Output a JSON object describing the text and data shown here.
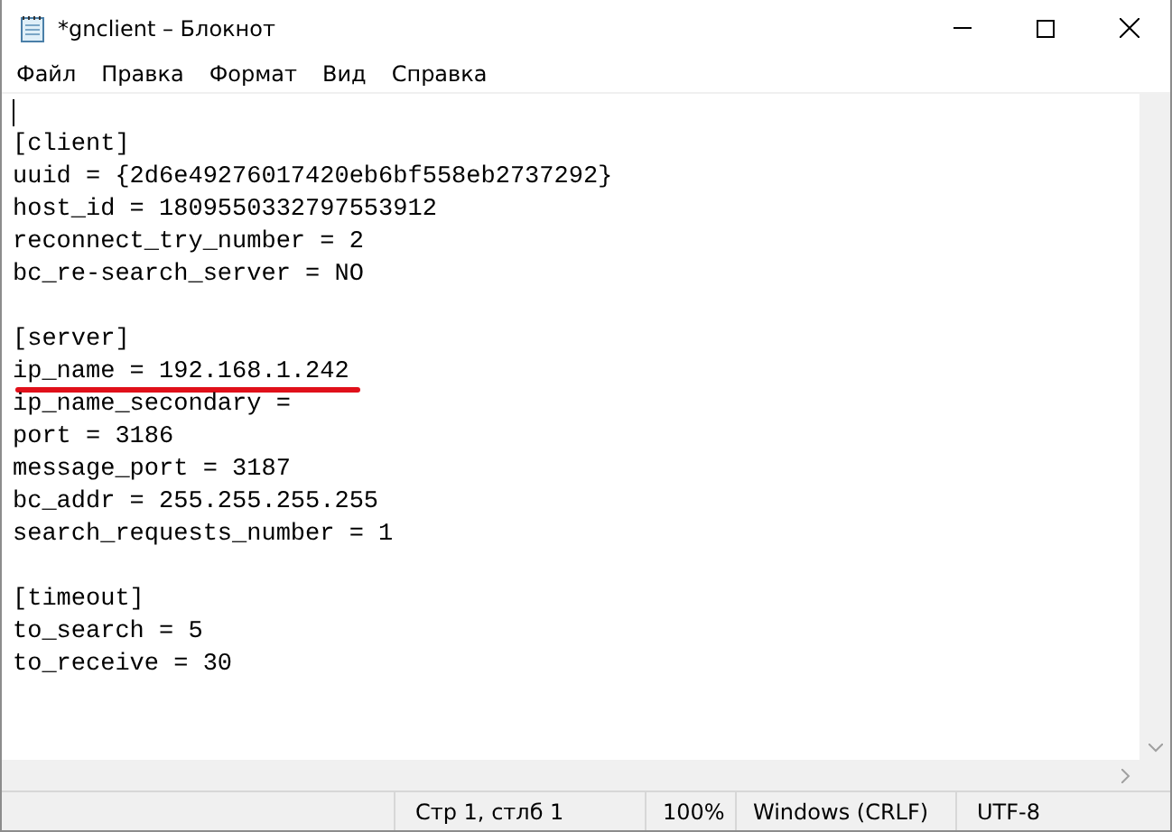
{
  "window": {
    "title": "*gnclient – Блокнот"
  },
  "menu": [
    "Файл",
    "Правка",
    "Формат",
    "Вид",
    "Справка"
  ],
  "editor": {
    "lines": [
      {
        "kind": "caret"
      },
      {
        "kind": "text",
        "text": "[client]"
      },
      {
        "kind": "text",
        "text": "uuid = {2d6e49276017420eb6bf558eb2737292}"
      },
      {
        "kind": "text",
        "text": "host_id = 1809550332797553912"
      },
      {
        "kind": "text",
        "text": "reconnect_try_number = 2"
      },
      {
        "kind": "text",
        "text": "bc_re-search_server = NO"
      },
      {
        "kind": "blank"
      },
      {
        "kind": "text",
        "text": "[server]"
      },
      {
        "kind": "text",
        "text": "ip_name = 192.168.1.242",
        "underlined": true
      },
      {
        "kind": "text",
        "text": "ip_name_secondary ="
      },
      {
        "kind": "text",
        "text": "port = 3186"
      },
      {
        "kind": "text",
        "text": "message_port = 3187"
      },
      {
        "kind": "text",
        "text": "bc_addr = 255.255.255.255"
      },
      {
        "kind": "text",
        "text": "search_requests_number = 1"
      },
      {
        "kind": "blank"
      },
      {
        "kind": "text",
        "text": "[timeout]"
      },
      {
        "kind": "text",
        "text": "to_search = 5"
      },
      {
        "kind": "text",
        "text": "to_receive = 30"
      }
    ]
  },
  "status_bar": {
    "position": "Стр 1, стлб 1",
    "zoom": "100%",
    "line_endings": "Windows (CRLF)",
    "encoding": "UTF-8"
  }
}
